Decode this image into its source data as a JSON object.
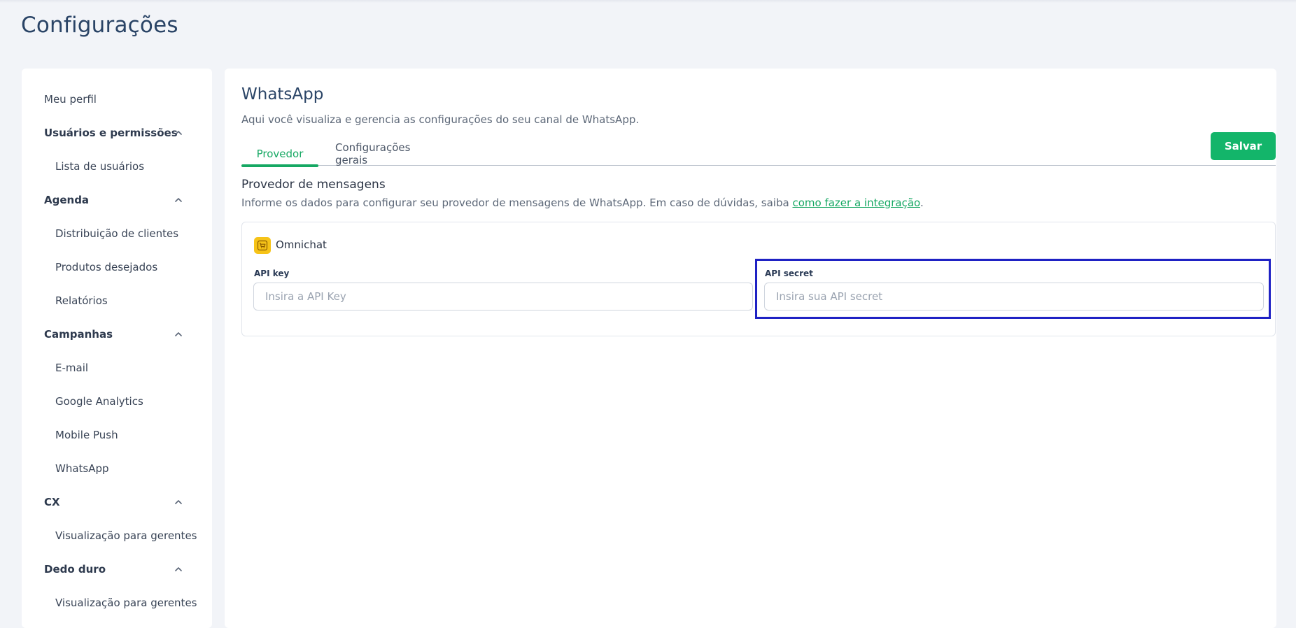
{
  "page": {
    "title": "Configurações"
  },
  "sidebar": {
    "items": [
      {
        "label": "Meu perfil",
        "kind": "top"
      },
      {
        "label": "Usuários e permissões",
        "kind": "section"
      },
      {
        "label": "Lista de usuários",
        "kind": "sub"
      },
      {
        "label": "Agenda",
        "kind": "section"
      },
      {
        "label": "Distribuição de clientes",
        "kind": "sub"
      },
      {
        "label": "Produtos desejados",
        "kind": "sub"
      },
      {
        "label": "Relatórios",
        "kind": "sub"
      },
      {
        "label": "Campanhas",
        "kind": "section"
      },
      {
        "label": "E-mail",
        "kind": "sub"
      },
      {
        "label": "Google Analytics",
        "kind": "sub"
      },
      {
        "label": "Mobile Push",
        "kind": "sub"
      },
      {
        "label": "WhatsApp",
        "kind": "sub"
      },
      {
        "label": "CX",
        "kind": "section"
      },
      {
        "label": "Visualização para gerentes",
        "kind": "sub"
      },
      {
        "label": "Dedo duro",
        "kind": "section"
      },
      {
        "label": "Visualização para gerentes",
        "kind": "sub"
      }
    ]
  },
  "main": {
    "title": "WhatsApp",
    "description": "Aqui você visualiza e gerencia as configurações do seu canal de WhatsApp.",
    "save_label": "Salvar",
    "tabs": [
      {
        "label": "Provedor",
        "active": true
      },
      {
        "label": "Configurações gerais",
        "active": false
      }
    ],
    "section": {
      "title": "Provedor de mensagens",
      "description": "Informe os dados para configurar seu provedor de mensagens de WhatsApp. Em caso de dúvidas, saiba ",
      "link_text": "como fazer a integração",
      "description_end": "."
    },
    "provider": {
      "name": "Omnichat",
      "icon": "cart-icon",
      "api_key": {
        "label": "API key",
        "placeholder": "Insira a API Key",
        "value": ""
      },
      "api_secret": {
        "label": "API secret",
        "placeholder": "Insira sua API secret",
        "value": ""
      }
    }
  },
  "colors": {
    "accent": "#13b56a",
    "title": "#2a4466",
    "highlight": "#1f22c4",
    "provider_logo": "#f6c318"
  }
}
